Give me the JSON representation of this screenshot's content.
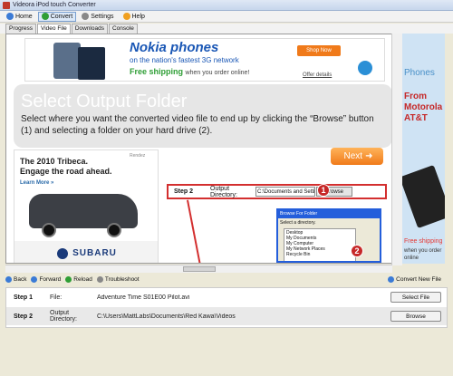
{
  "window": {
    "title": "Videora iPod touch Converter"
  },
  "menubar": {
    "home": "Home",
    "convert": "Convert",
    "settings": "Settings",
    "help": "Help"
  },
  "tabs": [
    "Progress",
    "Video File",
    "Downloads",
    "Console"
  ],
  "ad_banner": {
    "headline": "Nokia phones",
    "subline": "on the nation's fastest 3G network",
    "shipping": "Free shipping",
    "shipping_rest": "when you order online!",
    "shop_now": "Shop Now",
    "offer": "Offer details"
  },
  "panel": {
    "title": "Select Output Folder",
    "instructions": "Select where you want the converted video file to end up by clicking the “Browse” button (1) and selecting a folder on your hard drive (2)."
  },
  "next_button": "Next",
  "ad_left": {
    "label": "Rendez",
    "headline_1": "The 2010 Tribeca.",
    "headline_2": "Engage the road ahead.",
    "learn_more": "Learn More »",
    "brand": "SUBARU"
  },
  "inline_step2": {
    "step": "Step 2",
    "dir_label": "Output Directory:",
    "dir_value": "C:\\Documents and Setti",
    "browse": "Browse",
    "badge1": "1",
    "badge2": "2"
  },
  "dialog": {
    "title": "Browse For Folder",
    "instruction": "Select a directory.",
    "tree": [
      "Desktop",
      "My Documents",
      "My Computer",
      "My Network Places",
      "Recycle Bin"
    ]
  },
  "right_ad": {
    "l1": "Phones",
    "l2a": "From",
    "l2b": "Motorola",
    "l2c": "AT&T",
    "l3": "Free shipping",
    "l4": "when you order online"
  },
  "navbar": {
    "back": "Back",
    "forward": "Forward",
    "reload": "Reload",
    "troubleshoot": "Troubleshoot",
    "convert_new": "Convert New File"
  },
  "bottom": {
    "step1": {
      "step": "Step 1",
      "label": "File:",
      "value": "Adventure Time S01E00 Pilot.avi",
      "button": "Select File"
    },
    "step2": {
      "step": "Step 2",
      "label": "Output Directory:",
      "value": "C:\\Users\\MattLabs\\Documents\\Red Kawa\\Videos",
      "button": "Browse"
    }
  },
  "colors": {
    "accent": "#f07a1a",
    "badge": "#c62828",
    "link": "#1a57b5"
  }
}
